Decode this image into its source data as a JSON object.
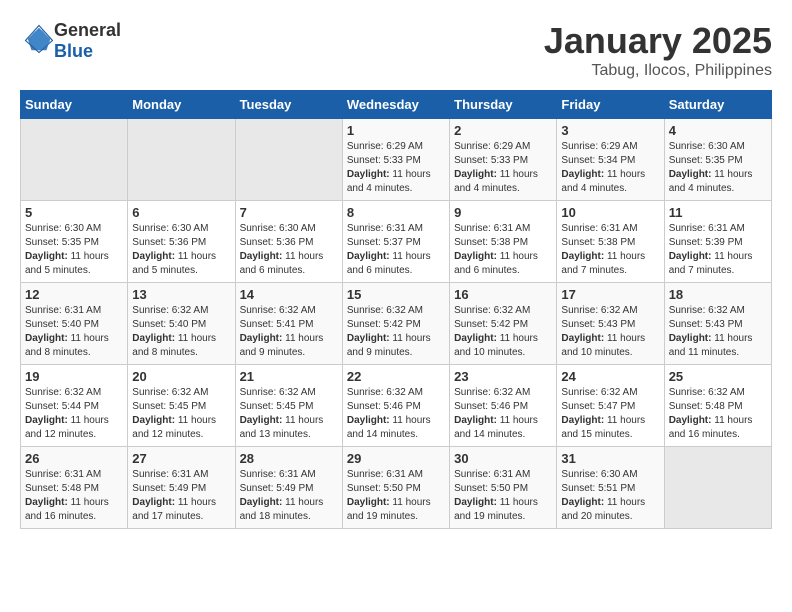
{
  "logo": {
    "text_general": "General",
    "text_blue": "Blue"
  },
  "title": "January 2025",
  "subtitle": "Tabug, Ilocos, Philippines",
  "days_of_week": [
    "Sunday",
    "Monday",
    "Tuesday",
    "Wednesday",
    "Thursday",
    "Friday",
    "Saturday"
  ],
  "weeks": [
    [
      {
        "day": "",
        "info": ""
      },
      {
        "day": "",
        "info": ""
      },
      {
        "day": "",
        "info": ""
      },
      {
        "day": "1",
        "info": "Sunrise: 6:29 AM\nSunset: 5:33 PM\nDaylight: 11 hours and 4 minutes."
      },
      {
        "day": "2",
        "info": "Sunrise: 6:29 AM\nSunset: 5:33 PM\nDaylight: 11 hours and 4 minutes."
      },
      {
        "day": "3",
        "info": "Sunrise: 6:29 AM\nSunset: 5:34 PM\nDaylight: 11 hours and 4 minutes."
      },
      {
        "day": "4",
        "info": "Sunrise: 6:30 AM\nSunset: 5:35 PM\nDaylight: 11 hours and 4 minutes."
      }
    ],
    [
      {
        "day": "5",
        "info": "Sunrise: 6:30 AM\nSunset: 5:35 PM\nDaylight: 11 hours and 5 minutes."
      },
      {
        "day": "6",
        "info": "Sunrise: 6:30 AM\nSunset: 5:36 PM\nDaylight: 11 hours and 5 minutes."
      },
      {
        "day": "7",
        "info": "Sunrise: 6:30 AM\nSunset: 5:36 PM\nDaylight: 11 hours and 6 minutes."
      },
      {
        "day": "8",
        "info": "Sunrise: 6:31 AM\nSunset: 5:37 PM\nDaylight: 11 hours and 6 minutes."
      },
      {
        "day": "9",
        "info": "Sunrise: 6:31 AM\nSunset: 5:38 PM\nDaylight: 11 hours and 6 minutes."
      },
      {
        "day": "10",
        "info": "Sunrise: 6:31 AM\nSunset: 5:38 PM\nDaylight: 11 hours and 7 minutes."
      },
      {
        "day": "11",
        "info": "Sunrise: 6:31 AM\nSunset: 5:39 PM\nDaylight: 11 hours and 7 minutes."
      }
    ],
    [
      {
        "day": "12",
        "info": "Sunrise: 6:31 AM\nSunset: 5:40 PM\nDaylight: 11 hours and 8 minutes."
      },
      {
        "day": "13",
        "info": "Sunrise: 6:32 AM\nSunset: 5:40 PM\nDaylight: 11 hours and 8 minutes."
      },
      {
        "day": "14",
        "info": "Sunrise: 6:32 AM\nSunset: 5:41 PM\nDaylight: 11 hours and 9 minutes."
      },
      {
        "day": "15",
        "info": "Sunrise: 6:32 AM\nSunset: 5:42 PM\nDaylight: 11 hours and 9 minutes."
      },
      {
        "day": "16",
        "info": "Sunrise: 6:32 AM\nSunset: 5:42 PM\nDaylight: 11 hours and 10 minutes."
      },
      {
        "day": "17",
        "info": "Sunrise: 6:32 AM\nSunset: 5:43 PM\nDaylight: 11 hours and 10 minutes."
      },
      {
        "day": "18",
        "info": "Sunrise: 6:32 AM\nSunset: 5:43 PM\nDaylight: 11 hours and 11 minutes."
      }
    ],
    [
      {
        "day": "19",
        "info": "Sunrise: 6:32 AM\nSunset: 5:44 PM\nDaylight: 11 hours and 12 minutes."
      },
      {
        "day": "20",
        "info": "Sunrise: 6:32 AM\nSunset: 5:45 PM\nDaylight: 11 hours and 12 minutes."
      },
      {
        "day": "21",
        "info": "Sunrise: 6:32 AM\nSunset: 5:45 PM\nDaylight: 11 hours and 13 minutes."
      },
      {
        "day": "22",
        "info": "Sunrise: 6:32 AM\nSunset: 5:46 PM\nDaylight: 11 hours and 14 minutes."
      },
      {
        "day": "23",
        "info": "Sunrise: 6:32 AM\nSunset: 5:46 PM\nDaylight: 11 hours and 14 minutes."
      },
      {
        "day": "24",
        "info": "Sunrise: 6:32 AM\nSunset: 5:47 PM\nDaylight: 11 hours and 15 minutes."
      },
      {
        "day": "25",
        "info": "Sunrise: 6:32 AM\nSunset: 5:48 PM\nDaylight: 11 hours and 16 minutes."
      }
    ],
    [
      {
        "day": "26",
        "info": "Sunrise: 6:31 AM\nSunset: 5:48 PM\nDaylight: 11 hours and 16 minutes."
      },
      {
        "day": "27",
        "info": "Sunrise: 6:31 AM\nSunset: 5:49 PM\nDaylight: 11 hours and 17 minutes."
      },
      {
        "day": "28",
        "info": "Sunrise: 6:31 AM\nSunset: 5:49 PM\nDaylight: 11 hours and 18 minutes."
      },
      {
        "day": "29",
        "info": "Sunrise: 6:31 AM\nSunset: 5:50 PM\nDaylight: 11 hours and 19 minutes."
      },
      {
        "day": "30",
        "info": "Sunrise: 6:31 AM\nSunset: 5:50 PM\nDaylight: 11 hours and 19 minutes."
      },
      {
        "day": "31",
        "info": "Sunrise: 6:30 AM\nSunset: 5:51 PM\nDaylight: 11 hours and 20 minutes."
      },
      {
        "day": "",
        "info": ""
      }
    ]
  ]
}
